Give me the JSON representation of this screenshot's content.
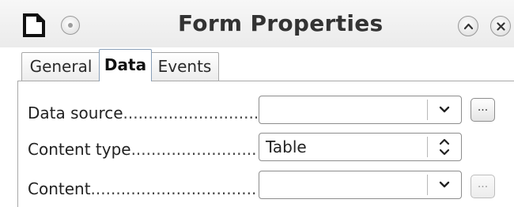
{
  "window": {
    "title": "Form Properties"
  },
  "tabs": [
    {
      "label": "General",
      "active": false
    },
    {
      "label": "Data",
      "active": true
    },
    {
      "label": "Events",
      "active": false
    }
  ],
  "fields": [
    {
      "label": "Data source",
      "value": "",
      "control": "dropdown",
      "button_label": "...",
      "button_enabled": true
    },
    {
      "label": "Content type",
      "value": "Table",
      "control": "spin-select"
    },
    {
      "label": "Content",
      "value": "",
      "control": "dropdown",
      "button_label": "...",
      "button_enabled": false
    }
  ],
  "leader_dots": "....................................................",
  "icons": {
    "app": "document-icon",
    "menu": "window-menu-icon",
    "shade": "chevron-up-icon",
    "close": "close-icon",
    "dropdown": "chevron-down-icon",
    "spin": "up-down-arrows-icon"
  }
}
